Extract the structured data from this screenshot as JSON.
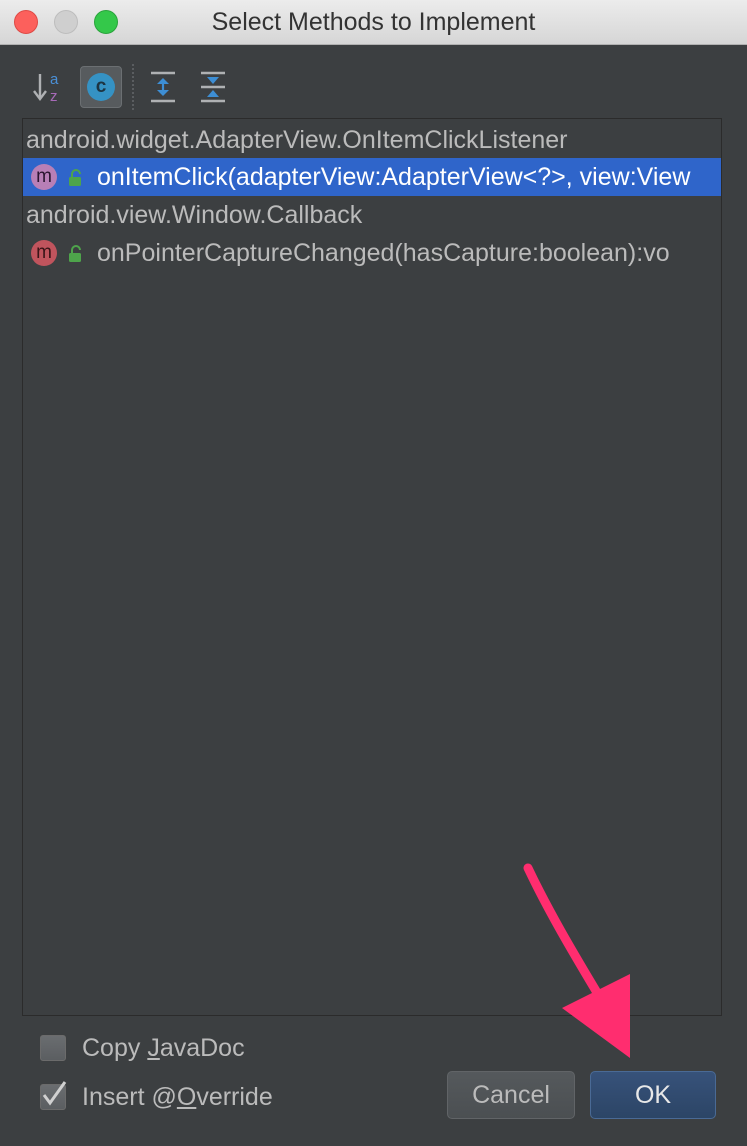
{
  "window": {
    "title": "Select Methods to Implement"
  },
  "toolbar": {
    "sort_icon": "sort-alphabetically-icon",
    "classes_icon": "show-classes-icon",
    "classes_glyph": "c",
    "expand_icon": "expand-all-icon",
    "collapse_icon": "collapse-all-icon"
  },
  "tree": {
    "groups": [
      {
        "label": "android.widget.AdapterView.OnItemClickListener",
        "methods": [
          {
            "icon_glyph": "m",
            "label": "onItemClick(adapterView:AdapterView<?>, view:View",
            "selected": true
          }
        ]
      },
      {
        "label": "android.view.Window.Callback",
        "methods": [
          {
            "icon_glyph": "m",
            "label": "onPointerCaptureChanged(hasCapture:boolean):vo",
            "selected": false
          }
        ]
      }
    ]
  },
  "options": {
    "copy_javadoc": {
      "pre": "Copy ",
      "mnemonic": "J",
      "post": "avaDoc",
      "checked": false
    },
    "insert_override": {
      "pre": "Insert @",
      "mnemonic": "O",
      "post": "verride",
      "checked": true
    }
  },
  "buttons": {
    "cancel": "Cancel",
    "ok": "OK"
  },
  "colors": {
    "selection": "#2f65ca",
    "annotation_arrow": "#ff2d6f"
  }
}
